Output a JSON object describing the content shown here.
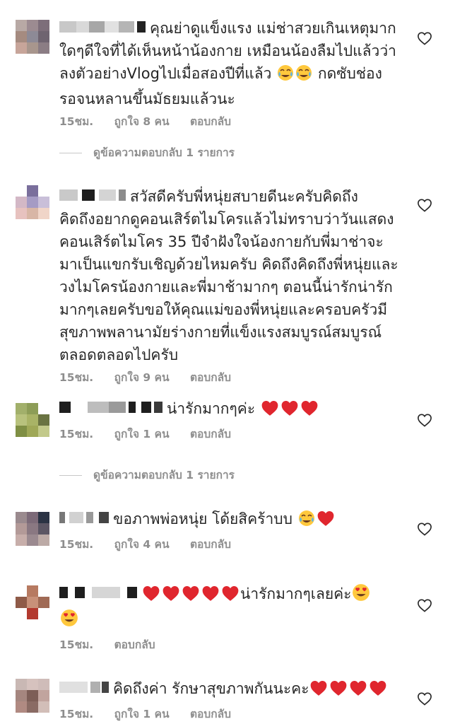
{
  "comments": [
    {
      "username": "",
      "text_lines": [
        "คุณย่าดูแข็งแรง แม่ช่าสวยเกินเหตุมาก",
        "ใดๆดีใจที่ได้เห็นหน้าน้องกาย เหมือนน้องลืมไปแล้วว่า",
        "ลงตัวอย่างVlogไปเมื่อสองปีที่แล้ว",
        "กดซับช่อง",
        "รอจนหลานขึ้นมัธยมแล้วนะ"
      ],
      "time": "15ชม.",
      "likes": "ถูกใจ 8 คน",
      "reply": "ตอบกลับ",
      "emoji": [
        "face-with-tears-of-joy-icon",
        "face-with-tears-of-joy-icon"
      ],
      "avatar_colors": [
        "#b8a9a5",
        "#9c8b91",
        "#7d6e7a",
        "#a58b80",
        "#8d8a96",
        "#6f6470",
        "#c7a59a",
        "#a8968d",
        "#8b7d84"
      ]
    },
    {
      "username": "",
      "text_lines": [
        "สวัสดีครับพี่หนุ่ยสบายดีนะครับคิดถึง",
        "คิดถึงอยากดูคอนเสิร์ตไมโครแล้วไม่ทราบว่าวันแสดง",
        "คอนเสิร์ตไมโคร 35 ปีจำฝังใจน้องกายกับพี่มาช่าจะ",
        "มาเป็นแขกรับเชิญด้วยไหมครับ คิดถึงคิดถึงพี่หนุ่ยและ",
        "วงไมโครน้องกายและพี่มาช้ามากๆ ตอนนี้น่ารักน่ารัก",
        "มากๆเลยครับขอให้คุณแม่ของพี่หนุ่ยและครอบครัวมี",
        "สุขภาพพลานามัยร่างกายที่แข็งแรงสมบูรณ์สมบูรณ์",
        "ตลอดตลอดไปครับ"
      ],
      "time": "15ชม.",
      "likes": "ถูกใจ 9 คน",
      "reply": "ตอบกลับ",
      "avatar_colors": [
        "#ffffff",
        "#7a6f9c",
        "#ffffff",
        "#d3b8c6",
        "#a59bc4",
        "#c9bfd9",
        "#e7c2bf",
        "#d8b6a6",
        "#f0d5c8"
      ]
    },
    {
      "username": "",
      "text": "น่ารักมากๆค่ะ",
      "time": "15ชม.",
      "likes": "ถูกใจ 1 คน",
      "reply": "ตอบกลับ",
      "emoji": [
        "red-heart-icon",
        "red-heart-icon",
        "red-heart-icon"
      ],
      "avatar_colors": [
        "#a2b06b",
        "#8d9d57",
        "#ffffff",
        "#b8c27d",
        "#a9b366",
        "#6a7342",
        "#7f8f44",
        "#9fa857",
        "#c2c98a"
      ]
    },
    {
      "username": "",
      "text": "ขอภาพพ่อหนุ่ย โด้ยสิคร้าบบ",
      "time": "15ชม.",
      "likes": "ถูกใจ 4 คน",
      "reply": "ตอบกลับ",
      "emoji": [
        "face-with-tears-of-joy-icon",
        "red-heart-icon"
      ],
      "avatar_colors": [
        "#9a8a8e",
        "#7c6a78",
        "#2b3344",
        "#b39a98",
        "#8a7882",
        "#5c5664",
        "#c7aeaa",
        "#9b8a90",
        "#bcaaa6"
      ]
    },
    {
      "username": "",
      "text_before": "",
      "text": "น่ารักมากๆเลยค่ะ",
      "time": "15ชม.",
      "reply": "ตอบกลับ",
      "emoji_before": [
        "red-heart-icon",
        "red-heart-icon",
        "red-heart-icon",
        "red-heart-icon",
        "red-heart-icon"
      ],
      "emoji_after": [
        "smiling-face-with-heart-eyes-icon",
        "smiling-face-with-heart-eyes-icon"
      ],
      "avatar_colors": [
        "#ffffff",
        "#b77a61",
        "#ffffff",
        "#8f5b48",
        "#c89179",
        "#a06a55",
        "#ffffff",
        "#b33a2f",
        "#ffffff"
      ]
    },
    {
      "username": "",
      "text": "คิดถึงค่า รักษาสุขภาพกันนะคะ",
      "time": "15ชม.",
      "likes": "ถูกใจ 1 คน",
      "reply": "ตอบกลับ",
      "emoji": [
        "red-heart-icon",
        "red-heart-icon",
        "red-heart-icon",
        "red-heart-icon"
      ],
      "avatar_colors": [
        "#c9b8b4",
        "#d6c2be",
        "#cfbcb9",
        "#a5867f",
        "#7d5e57",
        "#c1a49e",
        "#b08a82",
        "#8a6b64",
        "#d2beb8"
      ]
    }
  ],
  "view_replies_label": "ดูข้อความตอบกลับ 1 รายการ",
  "colors": {
    "text": "#262626",
    "meta": "#8e8e8e",
    "heart_red": "#ed4956"
  }
}
